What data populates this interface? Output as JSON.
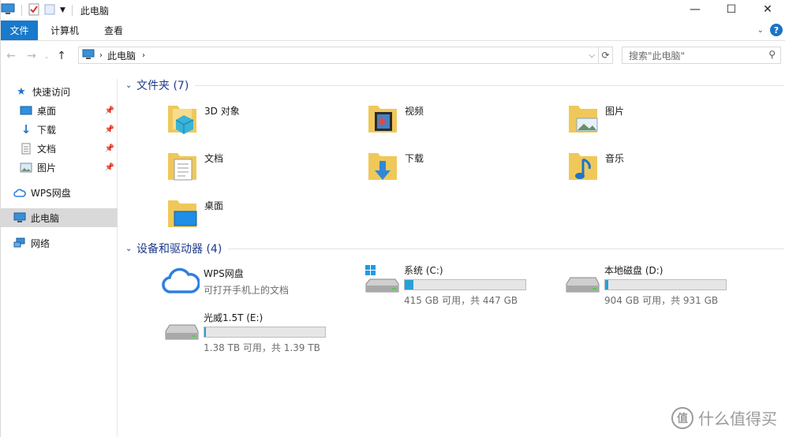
{
  "window": {
    "title": "此电脑"
  },
  "ribbon": {
    "tabs": [
      "文件",
      "计算机",
      "查看"
    ]
  },
  "address": {
    "crumb": "此电脑"
  },
  "search": {
    "placeholder": "搜索\"此电脑\""
  },
  "nav": {
    "quick_access": "快速访问",
    "items": [
      {
        "label": "桌面"
      },
      {
        "label": "下载"
      },
      {
        "label": "文档"
      },
      {
        "label": "图片"
      }
    ],
    "wps": "WPS网盘",
    "this_pc": "此电脑",
    "network": "网络"
  },
  "folders": {
    "title": "文件夹 (7)",
    "items": [
      "3D 对象",
      "视频",
      "图片",
      "文档",
      "下载",
      "音乐",
      "桌面"
    ]
  },
  "devices": {
    "title": "设备和驱动器 (4)",
    "wps": {
      "name": "WPS网盘",
      "sub": "可打开手机上的文档"
    },
    "drives": [
      {
        "name": "系统 (C:)",
        "free": "415 GB 可用，共 447 GB",
        "used_fraction": 0.072
      },
      {
        "name": "本地磁盘 (D:)",
        "free": "904 GB 可用，共 931 GB",
        "used_fraction": 0.029
      },
      {
        "name": "光威1.5T (E:)",
        "free": "1.38 TB 可用，共 1.39 TB",
        "used_fraction": 0.007
      }
    ]
  },
  "watermark": {
    "text": "什么值得买",
    "badge": "值"
  },
  "colors": {
    "accent": "#1979ca",
    "group_title": "#1e3a8a",
    "bar_fill": "#26a0da",
    "selected": "#d9d9d9"
  }
}
